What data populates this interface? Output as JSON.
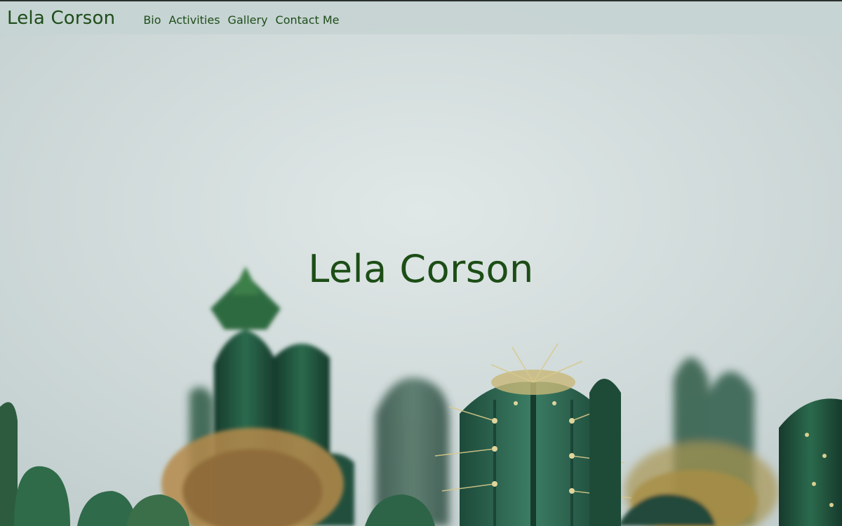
{
  "navbar": {
    "brand": "Lela Corson",
    "links": [
      {
        "label": "Bio"
      },
      {
        "label": "Activities"
      },
      {
        "label": "Gallery"
      },
      {
        "label": "Contact Me"
      }
    ]
  },
  "hero": {
    "title": "Lela Corson",
    "background_image": "cactus-photo"
  },
  "colors": {
    "brand_green": "#1f4d1a",
    "navbar_bg": "#c6d4d2",
    "sky": "#d6e0df"
  }
}
